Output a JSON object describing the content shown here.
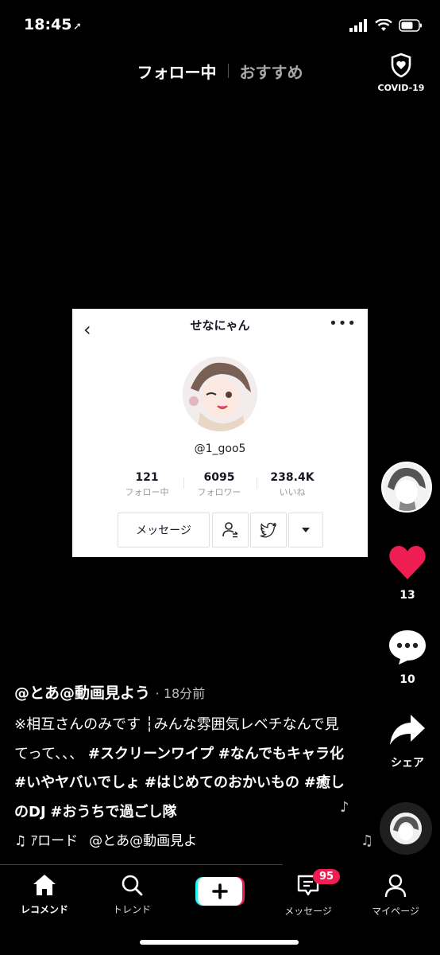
{
  "status_bar": {
    "time": "18:45"
  },
  "top_tabs": {
    "following": "フォロー中",
    "for_you": "おすすめ",
    "covid_label": "COVID-19"
  },
  "profile_card": {
    "name": "せなにゃん",
    "handle": "@1_goo5",
    "stats": [
      {
        "value": "121",
        "label": "フォロー中"
      },
      {
        "value": "6095",
        "label": "フォロワー"
      },
      {
        "value": "238.4K",
        "label": "いいね"
      }
    ],
    "message_button": "メッセージ"
  },
  "rail": {
    "likes": "13",
    "comments": "10",
    "share": "シェア"
  },
  "post": {
    "author": "@とあ@動画見よう",
    "time": "· 18分前",
    "caption_plain": "※相互さんのみです ┆みんな雰囲気レベチなんで見てって、、、",
    "hashtags": [
      "#スクリーンワイプ",
      "#なんでもキャラ化",
      "#いやヤバいでしょ",
      "#はじめてのおかいもの",
      "#癒しのDJ",
      "#おうちで過ごし隊"
    ],
    "music_title": "♫ ｱロード",
    "music_author": "@とあ@動画見よ"
  },
  "bottom_nav": {
    "home": "レコメンド",
    "trend": "トレンド",
    "messages": "メッセージ",
    "messages_badge": "95",
    "me": "マイページ"
  },
  "colors": {
    "like_red": "#ee1d52",
    "badge_red": "#ee1d52",
    "plus_cyan": "#25f4ee"
  }
}
